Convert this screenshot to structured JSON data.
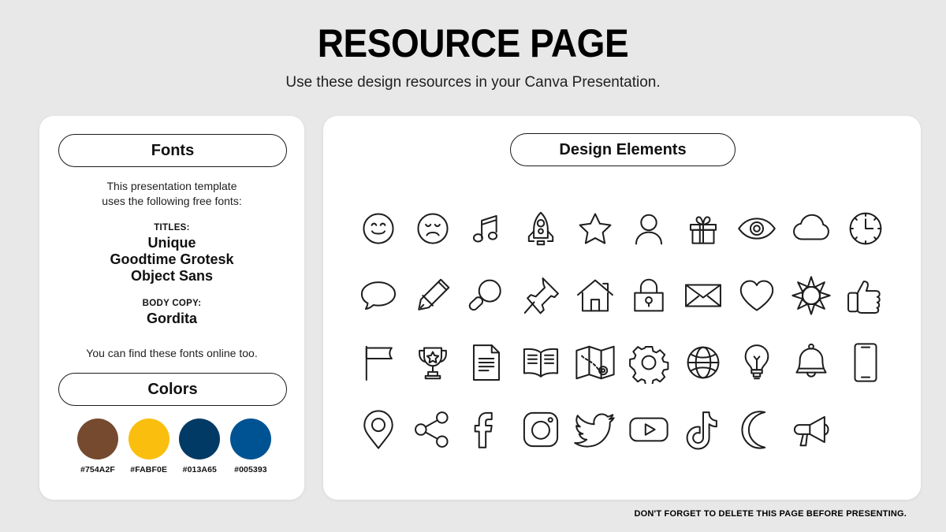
{
  "header": {
    "title": "RESOURCE PAGE",
    "subtitle": "Use these design resources in your Canva Presentation."
  },
  "fonts_panel": {
    "pill_label": "Fonts",
    "intro_line1": "This presentation template",
    "intro_line2": "uses the following free fonts:",
    "titles_label": "TITLES:",
    "title_fonts": [
      "Unique",
      "Goodtime Grotesk",
      "Object Sans"
    ],
    "body_label": "BODY COPY:",
    "body_fonts": [
      "Gordita"
    ],
    "outro": "You can find these fonts online too."
  },
  "colors_panel": {
    "pill_label": "Colors",
    "swatches": [
      {
        "hex": "#754A2F",
        "label": "#754A2F"
      },
      {
        "hex": "#FABF0E",
        "label": "#FABF0E"
      },
      {
        "hex": "#013A65",
        "label": "#013A65"
      },
      {
        "hex": "#005393",
        "label": "#005393"
      }
    ]
  },
  "design_panel": {
    "pill_label": "Design Elements",
    "icons": [
      "smiley-face-icon",
      "sad-face-icon",
      "music-note-icon",
      "rocket-icon",
      "star-icon",
      "person-icon",
      "gift-icon",
      "eye-icon",
      "cloud-icon",
      "clock-icon",
      "speech-bubble-icon",
      "pencil-icon",
      "magnifying-glass-icon",
      "pushpin-icon",
      "house-icon",
      "lock-icon",
      "envelope-icon",
      "heart-icon",
      "sun-icon",
      "thumbs-up-icon",
      "flag-icon",
      "trophy-icon",
      "document-icon",
      "open-book-icon",
      "map-icon",
      "gear-icon",
      "globe-icon",
      "lightbulb-icon",
      "bell-icon",
      "smartphone-icon",
      "location-pin-icon",
      "share-icon",
      "facebook-icon",
      "instagram-icon",
      "twitter-icon",
      "youtube-icon",
      "tiktok-icon",
      "moon-icon",
      "megaphone-icon"
    ]
  },
  "footer": {
    "note": "DON'T FORGET TO DELETE THIS PAGE BEFORE PRESENTING."
  }
}
